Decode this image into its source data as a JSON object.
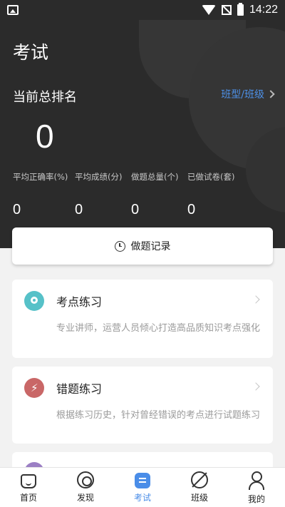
{
  "status_bar": {
    "time": "14:22"
  },
  "header": {
    "title": "考试",
    "rank_label": "当前总排名",
    "class_link": "班型/班级",
    "rank_value": "0"
  },
  "stats": [
    {
      "label": "平均正确率(%)",
      "value": "0"
    },
    {
      "label": "平均成绩(分)",
      "value": "0"
    },
    {
      "label": "做题总量(个)",
      "value": "0"
    },
    {
      "label": "已做试卷(套)",
      "value": "0"
    }
  ],
  "record_button": {
    "label": "做题记录",
    "icon": "clock-icon"
  },
  "cards": [
    {
      "title": "考点练习",
      "desc": "专业讲师，运营人员倾心打造高品质知识考点强化",
      "icon": "location-pin-icon",
      "color": "#56c1c8"
    },
    {
      "title": "错题练习",
      "desc": "根据练习历史，针对曾经错误的考点进行试题练习",
      "icon": "lightning-icon",
      "color": "#c96767"
    }
  ],
  "tabbar": {
    "active_color": "#4a8de8",
    "items": [
      {
        "label": "首页",
        "icon": "home-icon"
      },
      {
        "label": "发现",
        "icon": "discover-icon"
      },
      {
        "label": "考试",
        "icon": "exam-icon",
        "active": true
      },
      {
        "label": "班级",
        "icon": "class-icon"
      },
      {
        "label": "我的",
        "icon": "profile-icon"
      }
    ]
  }
}
